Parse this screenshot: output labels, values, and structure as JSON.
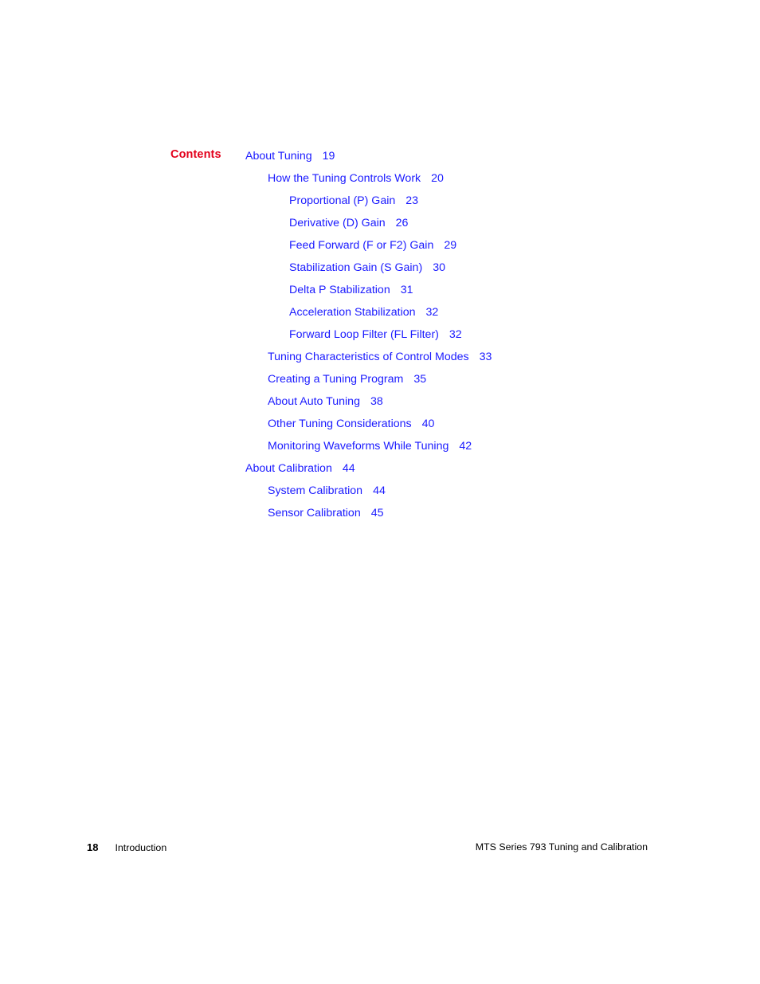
{
  "document": {
    "heading_label": "Contents"
  },
  "toc": {
    "entries": [
      {
        "title": "About Tuning",
        "page": "19",
        "level": 1
      },
      {
        "title": "How the Tuning Controls Work",
        "page": "20",
        "level": 2
      },
      {
        "title": "Proportional (P) Gain",
        "page": "23",
        "level": 3
      },
      {
        "title": "Derivative (D) Gain",
        "page": "26",
        "level": 3
      },
      {
        "title": "Feed Forward (F or F2) Gain",
        "page": "29",
        "level": 3
      },
      {
        "title": "Stabilization Gain (S Gain)",
        "page": "30",
        "level": 3
      },
      {
        "title": "Delta P Stabilization",
        "page": "31",
        "level": 3
      },
      {
        "title": "Acceleration Stabilization",
        "page": "32",
        "level": 3
      },
      {
        "title": "Forward Loop Filter (FL Filter)",
        "page": "32",
        "level": 3
      },
      {
        "title": "Tuning Characteristics of Control Modes",
        "page": "33",
        "level": 2
      },
      {
        "title": "Creating a Tuning Program",
        "page": "35",
        "level": 2
      },
      {
        "title": "About Auto Tuning",
        "page": "38",
        "level": 2
      },
      {
        "title": "Other Tuning Considerations",
        "page": "40",
        "level": 2
      },
      {
        "title": "Monitoring Waveforms While Tuning",
        "page": "42",
        "level": 2
      },
      {
        "title": "About Calibration",
        "page": "44",
        "level": 1
      },
      {
        "title": "System Calibration",
        "page": "44",
        "level": 2
      },
      {
        "title": "Sensor Calibration",
        "page": "45",
        "level": 2
      }
    ]
  },
  "footer": {
    "page_number": "18",
    "section": "Introduction",
    "manual_title": "MTS Series 793 Tuning and Calibration"
  },
  "colors": {
    "heading": "#e3001b",
    "toc_link": "#1a1aff",
    "footer_text": "#000000",
    "page_background": "#ffffff"
  }
}
